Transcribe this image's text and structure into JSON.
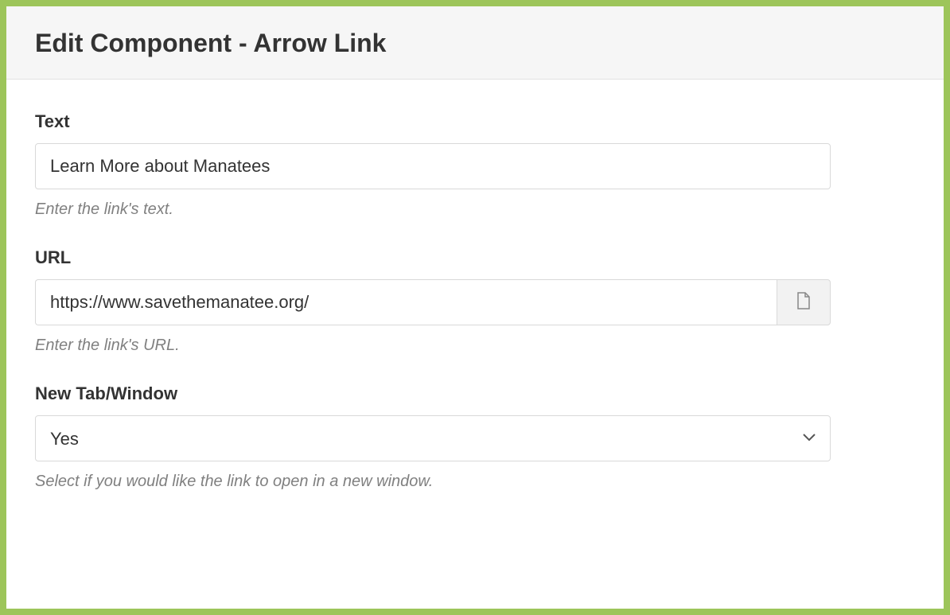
{
  "header": {
    "title": "Edit Component - Arrow Link"
  },
  "fields": {
    "text": {
      "label": "Text",
      "value": "Learn More about Manatees",
      "help": "Enter the link's text."
    },
    "url": {
      "label": "URL",
      "value": "https://www.savethemanatee.org/",
      "help": "Enter the link's URL."
    },
    "new_tab": {
      "label": "New Tab/Window",
      "selected": "Yes",
      "help": "Select if you would like the link to open in a new window."
    }
  }
}
